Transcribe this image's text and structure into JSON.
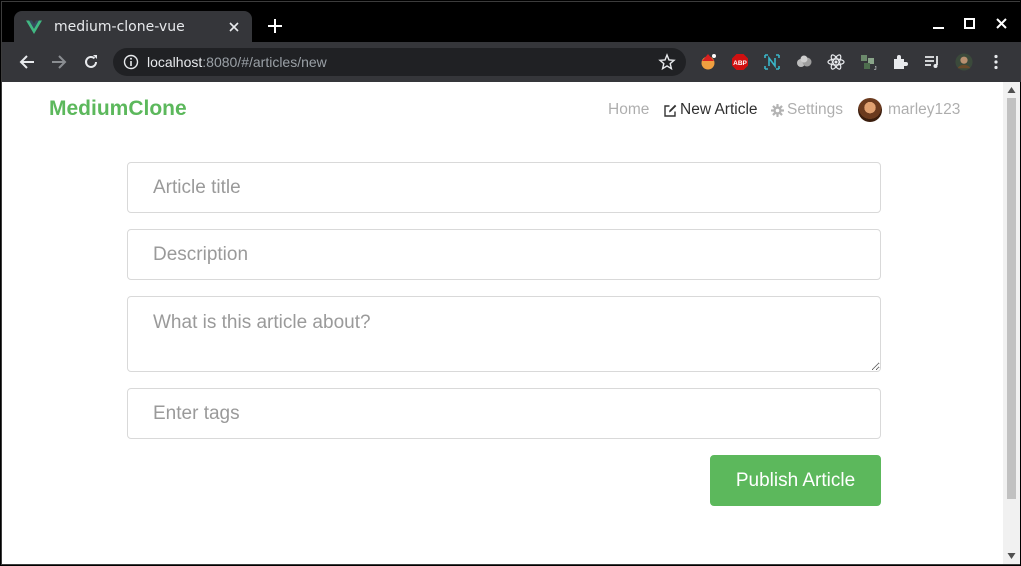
{
  "browser": {
    "tab_title": "medium-clone-vue",
    "url_host": "localhost",
    "url_rest": ":8080/#/articles/new"
  },
  "colors": {
    "accent": "#5cb85c"
  },
  "page": {
    "brand": "MediumClone",
    "nav": {
      "home": "Home",
      "new_article": "New Article",
      "settings": "Settings",
      "username": "marley123"
    },
    "form": {
      "title_placeholder": "Article title",
      "description_placeholder": "Description",
      "body_placeholder": "What is this article about?",
      "tags_placeholder": "Enter tags",
      "submit_label": "Publish Article"
    }
  }
}
